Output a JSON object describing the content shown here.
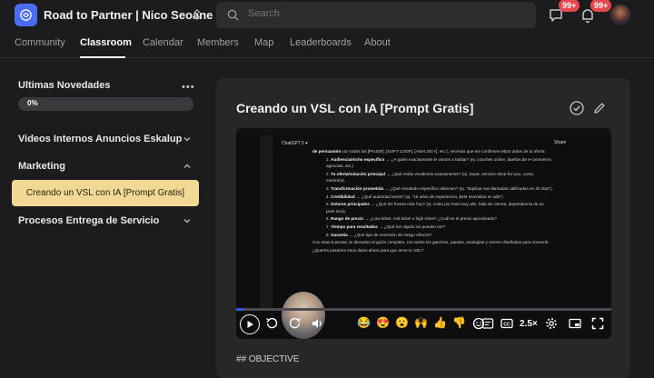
{
  "header": {
    "group_name": "Road to Partner | Nico Seoane",
    "search_placeholder": "Search",
    "chat_badge": "99+",
    "notifications_badge": "99+"
  },
  "tabs": [
    {
      "label": "Community",
      "active": false
    },
    {
      "label": "Classroom",
      "active": true
    },
    {
      "label": "Calendar",
      "active": false
    },
    {
      "label": "Members",
      "active": false
    },
    {
      "label": "Map",
      "active": false
    },
    {
      "label": "Leaderboards",
      "active": false
    },
    {
      "label": "About",
      "active": false
    }
  ],
  "sidebar": {
    "course_title": "Ultimas Novedades",
    "progress_label": "0%",
    "progress_fraction": 0.0,
    "sections": [
      {
        "title": "Videos Internos Anuncios Eskalup",
        "expanded": false
      },
      {
        "title": "Marketing",
        "expanded": true,
        "lessons": [
          "Creando un VSL con IA [Prompt Gratis]"
        ]
      },
      {
        "title": "Procesos Entrega de Servicio",
        "expanded": false
      }
    ]
  },
  "lesson": {
    "title": "Creando un VSL con IA [Prompt Gratis]",
    "objective": "## OBJECTIVE"
  },
  "video": {
    "app_title": "ChatGPT 5",
    "share_label": "Share",
    "intro": "con todos los [PAUSE], [SOFT LOOP], [ANALOGY], etc.), necesito que me confirmes estos datos de tu oferta:",
    "intro_bold": "de persuasión",
    "items": [
      {
        "n": "1.",
        "label": "Audiencia/nicho específico",
        "text": "→ ¿A quién exactamente le vamos a hablar? (ej. coaches online, dueños de e-commerce, agencias, etc.)"
      },
      {
        "n": "2.",
        "label": "Tu oferta/solución principal",
        "text": "→ ¿Qué estás vendiendo exactamente? (ej. SaaS, servicio done-for-you, curso, mentoría)."
      },
      {
        "n": "3.",
        "label": "Transformación prometida",
        "text": "→ ¿Qué resultado específico obtienen? (ej. \"duplicar sus llamadas calificadas en 30 días\")."
      },
      {
        "n": "4.",
        "label": "Credibilidad",
        "text": "→ ¿Qué autoridad tenés? (ej. \"15 años de experiencia, $4M invertidos en ads\")."
      },
      {
        "n": "5.",
        "label": "Dolores principales",
        "text": "→ ¿Qué les frustra más hoy? (ej. costo por lead muy alto, falta de cierres, dependencia de un pivel nivo)."
      },
      {
        "n": "6.",
        "label": "Rango de precio",
        "text": "→ ¿Low ticket, mid ticket o high ticket? ¿Cuál es el precio aproximado?"
      },
      {
        "n": "7.",
        "label": "Tiempo para resultados",
        "text": "→ ¿Qué tan rápido los pueden ver?"
      },
      {
        "n": "8.",
        "label": "Garantía",
        "text": "→ ¿Qué tipo de reversión de riesgo ofrecés?"
      }
    ],
    "outro": "Con esas 8 piezas, te devuelvo el guión completo, con todos los ganchos, pausas, analogías y cierres diseñados para convertir.",
    "question": "¿Querés pasarme esos datos ahora para que arme tu VSL?",
    "progress_fraction": 0.02,
    "speed": "2.5×",
    "reactions": [
      "😂",
      "😍",
      "😮",
      "🙌",
      "👍",
      "👎"
    ]
  }
}
